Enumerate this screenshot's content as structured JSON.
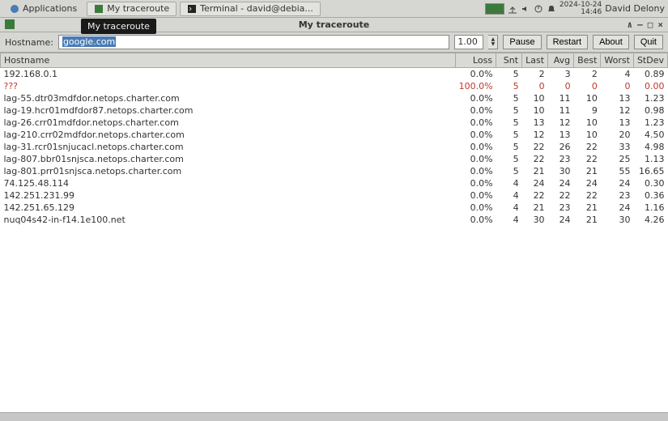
{
  "panel": {
    "applications_label": "Applications",
    "task1": "My traceroute",
    "task2": "Terminal - david@debia...",
    "date": "2024-10-24",
    "time": "14:46",
    "user": "David Delony"
  },
  "window": {
    "title": "My traceroute",
    "tooltip": "My traceroute",
    "min": "∧",
    "mid": "–",
    "max": "□",
    "close": "×"
  },
  "form": {
    "hostname_label": "Hostname:",
    "hostname_value": "google.com",
    "interval": "1.00",
    "pause": "Pause",
    "restart": "Restart",
    "about": "About",
    "quit": "Quit"
  },
  "table": {
    "headers": {
      "hostname": "Hostname",
      "loss": "Loss",
      "snt": "Snt",
      "last": "Last",
      "avg": "Avg",
      "best": "Best",
      "worst": "Worst",
      "stdev": "StDev"
    },
    "rows": [
      {
        "host": "192.168.0.1",
        "loss": "0.0%",
        "snt": "5",
        "last": "2",
        "avg": "3",
        "best": "2",
        "worst": "4",
        "stdev": "0.89",
        "error": false
      },
      {
        "host": "???",
        "loss": "100.0%",
        "snt": "5",
        "last": "0",
        "avg": "0",
        "best": "0",
        "worst": "0",
        "stdev": "0.00",
        "error": true
      },
      {
        "host": "lag-55.dtr03mdfdor.netops.charter.com",
        "loss": "0.0%",
        "snt": "5",
        "last": "10",
        "avg": "11",
        "best": "10",
        "worst": "13",
        "stdev": "1.23",
        "error": false
      },
      {
        "host": "lag-19.hcr01mdfdor87.netops.charter.com",
        "loss": "0.0%",
        "snt": "5",
        "last": "10",
        "avg": "11",
        "best": "9",
        "worst": "12",
        "stdev": "0.98",
        "error": false
      },
      {
        "host": "lag-26.crr01mdfdor.netops.charter.com",
        "loss": "0.0%",
        "snt": "5",
        "last": "13",
        "avg": "12",
        "best": "10",
        "worst": "13",
        "stdev": "1.23",
        "error": false
      },
      {
        "host": "lag-210.crr02mdfdor.netops.charter.com",
        "loss": "0.0%",
        "snt": "5",
        "last": "12",
        "avg": "13",
        "best": "10",
        "worst": "20",
        "stdev": "4.50",
        "error": false
      },
      {
        "host": "lag-31.rcr01snjucacl.netops.charter.com",
        "loss": "0.0%",
        "snt": "5",
        "last": "22",
        "avg": "26",
        "best": "22",
        "worst": "33",
        "stdev": "4.98",
        "error": false
      },
      {
        "host": "lag-807.bbr01snjsca.netops.charter.com",
        "loss": "0.0%",
        "snt": "5",
        "last": "22",
        "avg": "23",
        "best": "22",
        "worst": "25",
        "stdev": "1.13",
        "error": false
      },
      {
        "host": "lag-801.prr01snjsca.netops.charter.com",
        "loss": "0.0%",
        "snt": "5",
        "last": "21",
        "avg": "30",
        "best": "21",
        "worst": "55",
        "stdev": "16.65",
        "error": false
      },
      {
        "host": "74.125.48.114",
        "loss": "0.0%",
        "snt": "4",
        "last": "24",
        "avg": "24",
        "best": "24",
        "worst": "24",
        "stdev": "0.30",
        "error": false
      },
      {
        "host": "142.251.231.99",
        "loss": "0.0%",
        "snt": "4",
        "last": "22",
        "avg": "22",
        "best": "22",
        "worst": "23",
        "stdev": "0.36",
        "error": false
      },
      {
        "host": "142.251.65.129",
        "loss": "0.0%",
        "snt": "4",
        "last": "21",
        "avg": "23",
        "best": "21",
        "worst": "24",
        "stdev": "1.16",
        "error": false
      },
      {
        "host": "nuq04s42-in-f14.1e100.net",
        "loss": "0.0%",
        "snt": "4",
        "last": "30",
        "avg": "24",
        "best": "21",
        "worst": "30",
        "stdev": "4.26",
        "error": false
      }
    ]
  }
}
